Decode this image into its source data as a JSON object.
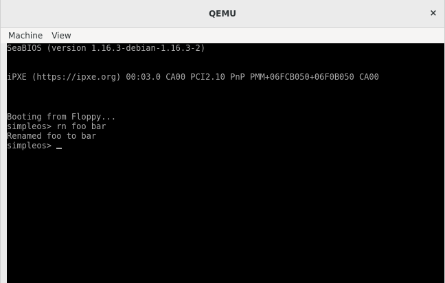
{
  "window": {
    "title": "QEMU",
    "close_glyph": "×"
  },
  "menubar": {
    "machine": "Machine",
    "view": "View"
  },
  "console": {
    "lines": [
      "SeaBIOS (version 1.16.3-debian-1.16.3-2)",
      "iPXE (https://ipxe.org) 00:03.0 CA00 PCI2.10 PnP PMM+06FCB050+06F0B050 CA00",
      "Booting from Floppy...",
      "simpleos> rn foo bar",
      "Renamed foo to bar",
      "simpleos> "
    ],
    "foreground": "#aaaaaa",
    "background": "#000000"
  }
}
